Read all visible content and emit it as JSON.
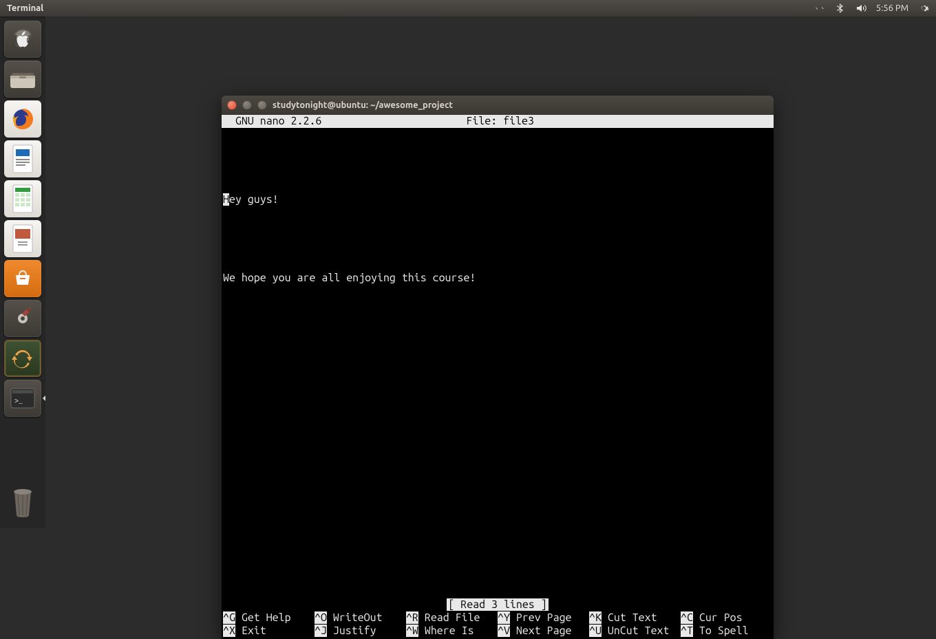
{
  "topbar": {
    "app_name": "Terminal",
    "clock": "5:56 PM",
    "indicators": [
      "network-icon",
      "bluetooth-icon",
      "volume-icon",
      "clock",
      "gear-icon"
    ]
  },
  "launcher": {
    "items": [
      {
        "name": "dash-icon",
        "label": "Dash"
      },
      {
        "name": "files-icon",
        "label": "Files"
      },
      {
        "name": "firefox-icon",
        "label": "Firefox"
      },
      {
        "name": "writer-icon",
        "label": "LibreOffice Writer"
      },
      {
        "name": "calc-icon",
        "label": "LibreOffice Calc"
      },
      {
        "name": "impress-icon",
        "label": "LibreOffice Impress"
      },
      {
        "name": "software-center-icon",
        "label": "Ubuntu Software Center"
      },
      {
        "name": "settings-icon",
        "label": "System Settings"
      },
      {
        "name": "updater-icon",
        "label": "Software Updater"
      },
      {
        "name": "terminal-icon",
        "label": "Terminal",
        "active": true
      }
    ],
    "trash_label": "Trash"
  },
  "window": {
    "title": "studytonight@ubuntu: ~/awesome_project"
  },
  "nano": {
    "app": "  GNU nano 2.2.6",
    "file_label": "File: file3",
    "lines": [
      "Hey guys!",
      "",
      "We hope you are all enjoying this course!"
    ],
    "status": "[ Read 3 lines ]",
    "shortcuts": [
      {
        "key": "^G",
        "label": "Get Help"
      },
      {
        "key": "^O",
        "label": "WriteOut"
      },
      {
        "key": "^R",
        "label": "Read File"
      },
      {
        "key": "^Y",
        "label": "Prev Page"
      },
      {
        "key": "^K",
        "label": "Cut Text"
      },
      {
        "key": "^C",
        "label": "Cur Pos"
      },
      {
        "key": "^X",
        "label": "Exit"
      },
      {
        "key": "^J",
        "label": "Justify"
      },
      {
        "key": "^W",
        "label": "Where Is"
      },
      {
        "key": "^V",
        "label": "Next Page"
      },
      {
        "key": "^U",
        "label": "UnCut Text"
      },
      {
        "key": "^T",
        "label": "To Spell"
      }
    ]
  }
}
